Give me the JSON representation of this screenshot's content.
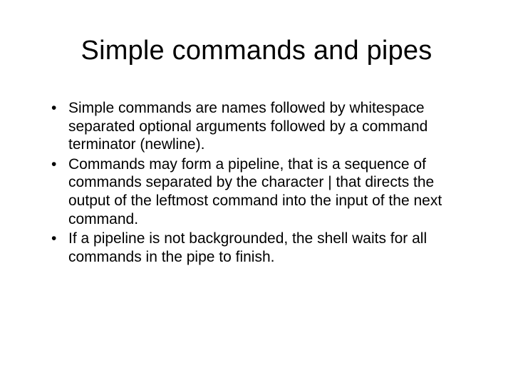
{
  "slide": {
    "title": "Simple commands and pipes",
    "bullets": [
      "Simple commands are names followed by whitespace separated optional arguments followed by a command terminator (newline).",
      "Commands may form a pipeline, that is a sequence of commands separated by the character | that directs the output of the leftmost command into the input of the next command.",
      "If a pipeline is not backgrounded, the shell waits for all commands in the pipe to finish."
    ]
  }
}
